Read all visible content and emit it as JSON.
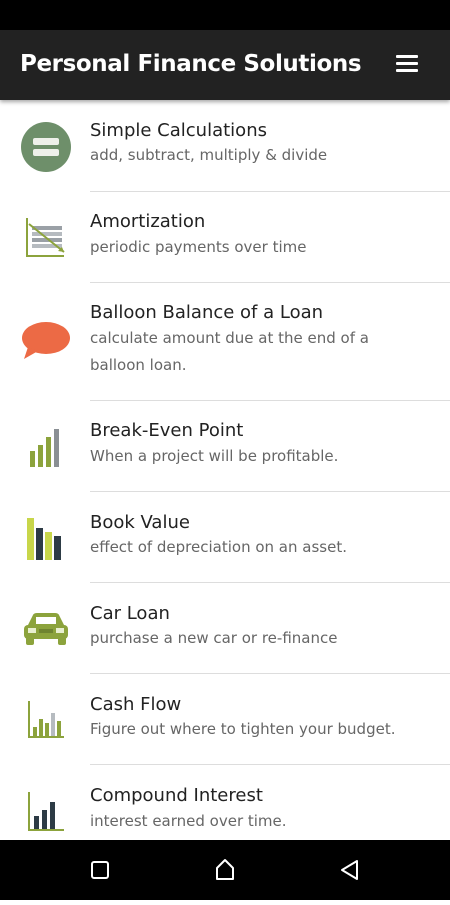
{
  "app_bar": {
    "title": "Personal Finance Solutions",
    "menu_icon": "hamburger-menu-icon"
  },
  "items": [
    {
      "title": "Simple Calculations",
      "subtitle": "add, subtract, multiply & divide",
      "icon": "equals-icon"
    },
    {
      "title": "Amortization",
      "subtitle": "periodic payments over time",
      "icon": "amortization-chart-icon"
    },
    {
      "title": "Balloon Balance of a Loan",
      "subtitle": "calculate amount due at the end of a balloon loan.",
      "icon": "speech-balloon-icon"
    },
    {
      "title": "Break-Even Point",
      "subtitle": "When a project will be profitable.",
      "icon": "bar-chart-icon"
    },
    {
      "title": "Book Value",
      "subtitle": "effect of depreciation on an asset.",
      "icon": "books-icon"
    },
    {
      "title": "Car Loan",
      "subtitle": "purchase a new car or re-finance",
      "icon": "car-icon"
    },
    {
      "title": "Cash Flow",
      "subtitle": "Figure out where to tighten your budget.",
      "icon": "cash-flow-chart-icon"
    },
    {
      "title": "Compound Interest",
      "subtitle": "interest earned over time.",
      "icon": "growth-chart-icon"
    }
  ],
  "nav": {
    "recents_icon": "square-recents-icon",
    "home_icon": "home-icon",
    "back_icon": "triangle-back-icon"
  },
  "colors": {
    "app_bar": "#222222",
    "accent_green": "#8ca33c",
    "icon_dark": "#2d3b45",
    "balloon": "#ec6a45",
    "circle": "#6e8f6a"
  }
}
